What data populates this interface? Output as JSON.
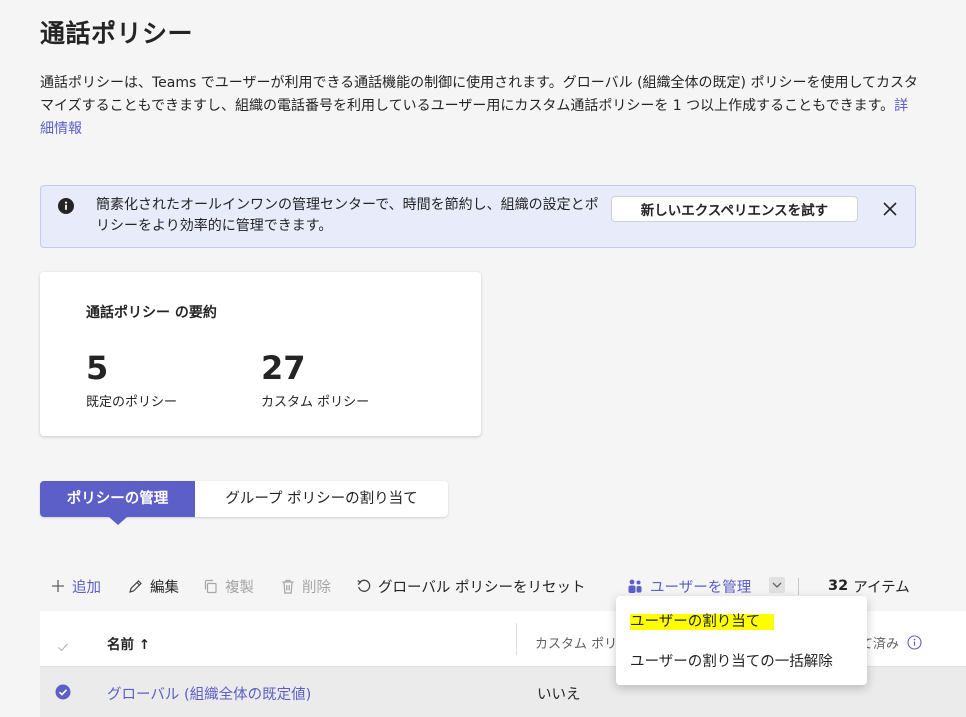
{
  "page": {
    "title": "通話ポリシー",
    "description": "通話ポリシーは、Teams でユーザーが利用できる通話機能の制御に使用されます。グローバル (組織全体の既定) ポリシーを使用してカスタマイズすることもできますし、組織の電話番号を利用しているユーザー用にカスタム通話ポリシーを 1 つ以上作成することもできます。",
    "learn_more": "詳細情報"
  },
  "banner": {
    "icon": "info-icon",
    "text": "簡素化されたオールインワンの管理センターで、時間を節約し、組織の設定とポリシーをより効率的に管理できます。",
    "button_label": "新しいエクスペリエンスを試す",
    "close_icon": "close-icon",
    "background_color": "#e8ebfa"
  },
  "summary": {
    "title": "通話ポリシー の要約",
    "stats": [
      {
        "value": "5",
        "label": "既定のポリシー"
      },
      {
        "value": "27",
        "label": "カスタム ポリシー"
      }
    ]
  },
  "tabs": [
    {
      "label": "ポリシーの管理",
      "active": true
    },
    {
      "label": "グループ ポリシーの割り当て",
      "active": false
    }
  ],
  "commandbar": {
    "add": "追加",
    "edit": "編集",
    "duplicate": "複製",
    "delete": "削除",
    "reset": "グローバル ポリシーをリセット",
    "manage_users": "ユーザーを管理",
    "item_count": "32",
    "item_unit": "アイテム"
  },
  "table": {
    "headers": {
      "name": "名前 ↑",
      "col2": "カスタム ポリ",
      "col3": "て済み"
    },
    "rows": [
      {
        "name": "グローバル (組織全体の既定値)",
        "custom": "いいえ",
        "selected": true
      }
    ]
  },
  "dropdown": {
    "items": [
      "ユーザーの割り当て",
      "ユーザーの割り当ての一括解除"
    ]
  },
  "colors": {
    "accent": "#5b5fc7",
    "highlight": "#ffff00"
  }
}
